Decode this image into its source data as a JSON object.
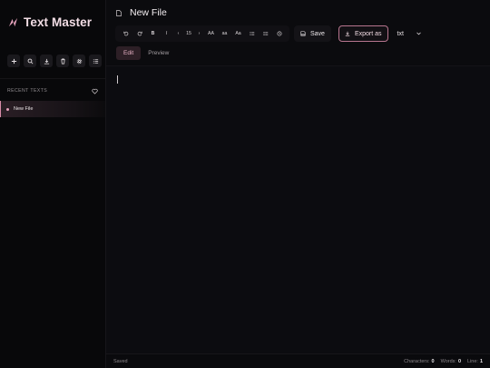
{
  "app": {
    "title": "Text Master",
    "accent": "#e3a1bb"
  },
  "sidebar": {
    "tools": [
      {
        "name": "new-file",
        "icon": "plus-icon"
      },
      {
        "name": "search",
        "icon": "search-icon"
      },
      {
        "name": "download",
        "icon": "download-icon"
      },
      {
        "name": "delete",
        "icon": "trash-icon"
      },
      {
        "name": "settings",
        "icon": "gear-icon"
      },
      {
        "name": "list",
        "icon": "list-icon"
      }
    ],
    "recent_title": "RECENT TEXTS",
    "files": [
      {
        "label": "New File",
        "active": true
      }
    ]
  },
  "document": {
    "title": "New File"
  },
  "toolbar": {
    "bold": "B",
    "italic": "I",
    "decrease": "‹",
    "font_size": "15",
    "increase": "›",
    "uppercase": "AA",
    "lowercase": "aa",
    "capitalize": "Aa",
    "save_label": "Save",
    "export_label": "Export as",
    "format_value": "txt"
  },
  "modes": {
    "edit": "Edit",
    "preview": "Preview",
    "active": "edit"
  },
  "status": {
    "state": "Saved",
    "characters_label": "Characters:",
    "characters_value": "0",
    "words_label": "Words:",
    "words_value": "0",
    "line_label": "Line:",
    "line_value": "1"
  }
}
